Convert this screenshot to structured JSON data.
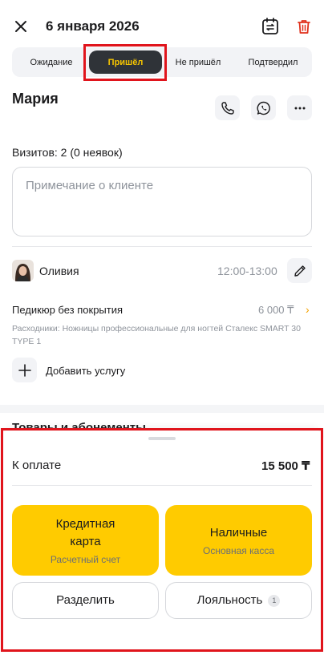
{
  "header": {
    "close_icon": "close-icon",
    "title": "6 января 2026",
    "calendar_icon": "calendar-swap-icon",
    "trash_icon": "trash-icon",
    "trash_color": "#e0311c"
  },
  "status_tabs": [
    {
      "label": "Ожидание",
      "active": false
    },
    {
      "label": "Пришёл",
      "active": true
    },
    {
      "label": "Не пришёл",
      "active": false
    },
    {
      "label": "Подтвердил",
      "active": false
    }
  ],
  "client": {
    "name": "Мария",
    "visits": "Визитов: 2 (0 неявок)",
    "note_placeholder": "Примечание о клиенте"
  },
  "appointment": {
    "staff_name": "Оливия",
    "time": "12:00-13:00",
    "service_name": "Педикюр без покрытия",
    "service_price": "6 000 ₸",
    "service_note": "Расходники: Ножницы профессиональные для ногтей Сталекс SMART 30 TYPE 1",
    "add_service_label": "Добавить услугу"
  },
  "goods_section_title": "Товары и абонементы",
  "payment_sheet": {
    "total_label": "К оплате",
    "total_amount": "15 500 ₸",
    "card_main": "Кредитная карта",
    "card_sub": "Расчетный счет",
    "cash_main": "Наличные",
    "cash_sub": "Основная касса",
    "split_label": "Разделить",
    "loyalty_label": "Лояльность",
    "loyalty_count": "1"
  },
  "colors": {
    "accent_yellow": "#ffcb00",
    "active_tab_bg": "#2f3338",
    "active_tab_text": "#f5c400",
    "highlight_red": "#e0141c"
  }
}
